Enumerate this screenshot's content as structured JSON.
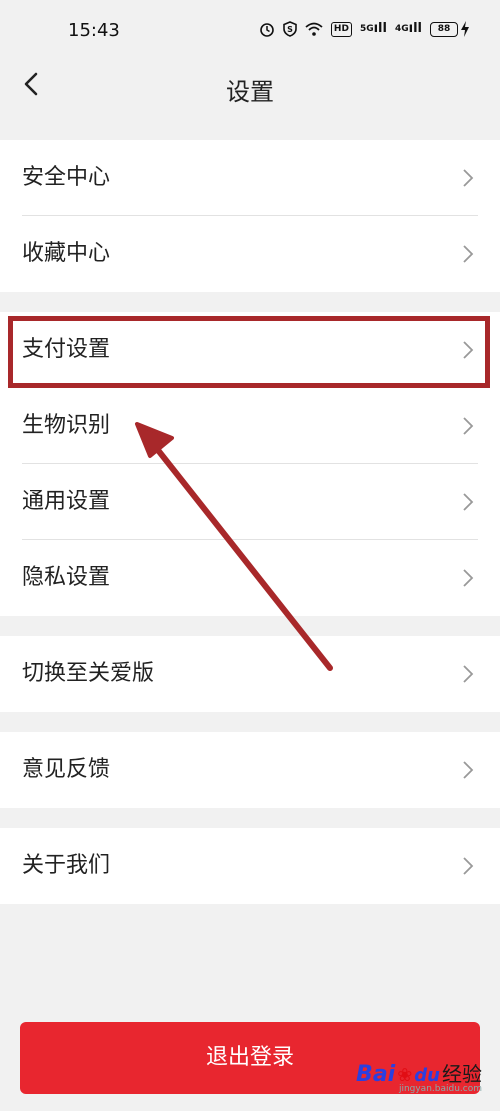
{
  "status_bar": {
    "time": "15:43",
    "icons": [
      "alarm-icon",
      "shield-icon",
      "wifi-icon",
      "hd-icon",
      "signal-5g-icon",
      "signal-4g-icon",
      "battery-icon",
      "charging-icon"
    ],
    "hd_label": "HD",
    "net1": "5G",
    "net2": "4G",
    "battery": "88"
  },
  "header": {
    "title": "设置"
  },
  "groups": [
    {
      "items": [
        {
          "label": "安全中心"
        },
        {
          "label": "收藏中心"
        }
      ]
    },
    {
      "items": [
        {
          "label": "支付设置"
        },
        {
          "label": "生物识别"
        },
        {
          "label": "通用设置"
        },
        {
          "label": "隐私设置"
        }
      ]
    },
    {
      "items": [
        {
          "label": "切换至关爱版"
        }
      ]
    },
    {
      "items": [
        {
          "label": "意见反馈"
        }
      ]
    },
    {
      "items": [
        {
          "label": "关于我们"
        }
      ]
    }
  ],
  "logout": {
    "label": "退出登录"
  },
  "watermark": {
    "brand": "Bai",
    "paw": "du",
    "name": "经验",
    "url": "jingyan.baidu.com"
  },
  "colors": {
    "accent": "#e8262f",
    "annotation": "#a8282a",
    "background": "#f1f1f1"
  }
}
